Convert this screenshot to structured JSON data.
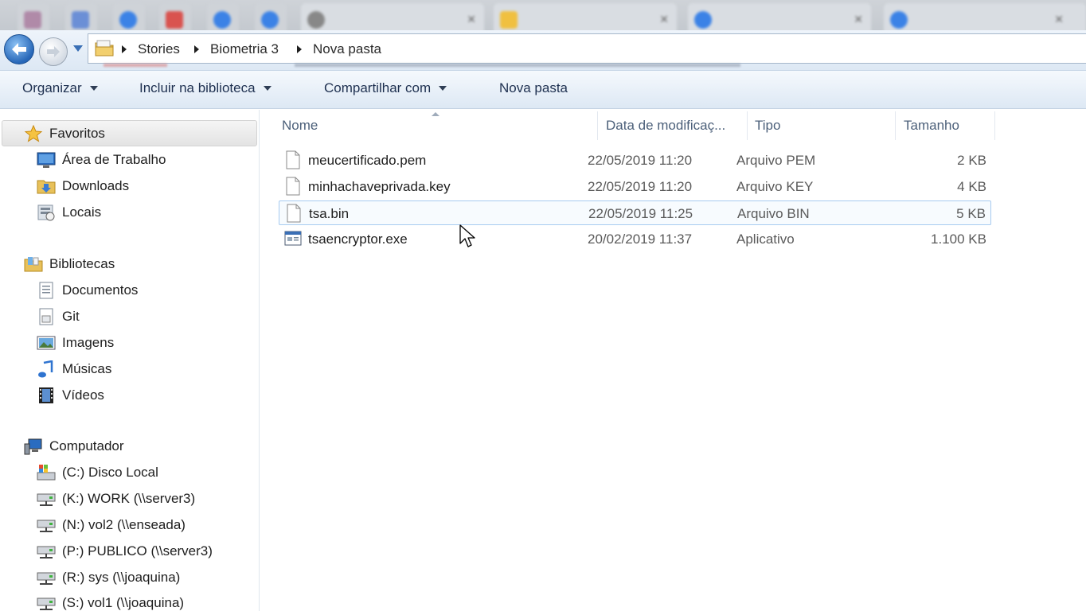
{
  "browser_tabs": [
    {
      "label": "",
      "color": "#b08aa8"
    },
    {
      "label": "",
      "color": "#6b8fd6"
    },
    {
      "label": "",
      "color": "#3b82e6"
    },
    {
      "label": "",
      "color": "#d9534f"
    },
    {
      "label": "",
      "color": "#3b82e6"
    },
    {
      "label": "",
      "color": "#3b82e6"
    },
    {
      "label": "",
      "color": "#888888"
    },
    {
      "label": "",
      "color": "#f0c040"
    },
    {
      "label": "",
      "color": "#3b82e6"
    },
    {
      "label": "",
      "color": "#3b82e6"
    }
  ],
  "address_bar": {
    "breadcrumbs": [
      "Stories",
      "Biometria 3",
      "Nova pasta"
    ]
  },
  "command_bar": {
    "organize": "Organizar",
    "include_library": "Incluir na biblioteca",
    "share_with": "Compartilhar com",
    "new_folder": "Nova pasta"
  },
  "nav_pane": {
    "favorites": {
      "label": "Favoritos",
      "items": [
        {
          "label": "Área de Trabalho",
          "icon": "desktop-icon"
        },
        {
          "label": "Downloads",
          "icon": "downloads-folder-icon"
        },
        {
          "label": "Locais",
          "icon": "recent-places-icon"
        }
      ]
    },
    "libraries": {
      "label": "Bibliotecas",
      "items": [
        {
          "label": "Documentos",
          "icon": "documents-icon"
        },
        {
          "label": "Git",
          "icon": "git-library-icon"
        },
        {
          "label": "Imagens",
          "icon": "pictures-icon"
        },
        {
          "label": "Músicas",
          "icon": "music-icon"
        },
        {
          "label": "Vídeos",
          "icon": "videos-icon"
        }
      ]
    },
    "computer": {
      "label": "Computador",
      "items": [
        {
          "label": "(C:) Disco Local",
          "icon": "local-disk-icon"
        },
        {
          "label": "(K:) WORK (\\\\server3)",
          "icon": "network-drive-icon"
        },
        {
          "label": "(N:) vol2 (\\\\enseada)",
          "icon": "network-drive-icon"
        },
        {
          "label": "(P:) PUBLICO (\\\\server3)",
          "icon": "network-drive-icon"
        },
        {
          "label": "(R:) sys (\\\\joaquina)",
          "icon": "network-drive-icon"
        },
        {
          "label": "(S:) vol1 (\\\\joaquina)",
          "icon": "network-drive-icon"
        }
      ]
    }
  },
  "columns": {
    "name": "Nome",
    "date": "Data de modificaç...",
    "type": "Tipo",
    "size": "Tamanho"
  },
  "files": [
    {
      "name": "meucertificado.pem",
      "date": "22/05/2019 11:20",
      "type": "Arquivo PEM",
      "size": "2 KB",
      "icon": "document-file-icon"
    },
    {
      "name": "minhachaveprivada.key",
      "date": "22/05/2019 11:20",
      "type": "Arquivo KEY",
      "size": "4 KB",
      "icon": "document-file-icon"
    },
    {
      "name": "tsa.bin",
      "date": "22/05/2019 11:25",
      "type": "Arquivo BIN",
      "size": "5 KB",
      "icon": "document-file-icon"
    },
    {
      "name": "tsaencryptor.exe",
      "date": "20/02/2019 11:37",
      "type": "Aplicativo",
      "size": "1.100 KB",
      "icon": "application-exe-icon"
    }
  ],
  "colors": {
    "accent": "#3a75c4",
    "command_text": "#1e3050",
    "hover_border": "#a7cbf0",
    "column_header_text": "#4c607a"
  }
}
